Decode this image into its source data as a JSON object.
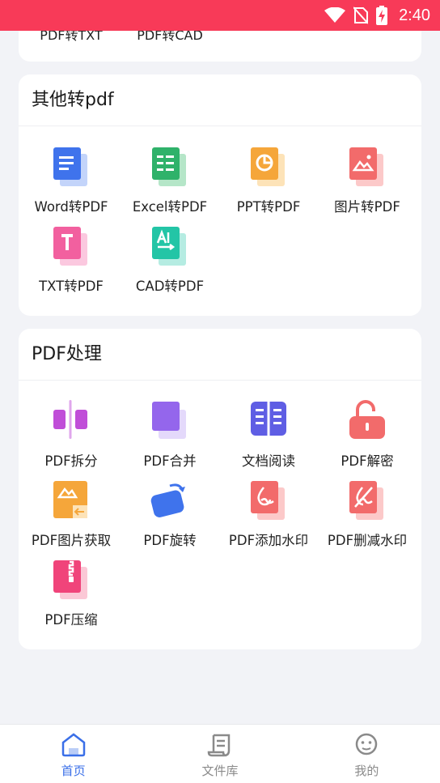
{
  "status_bar": {
    "time": "2:40"
  },
  "top_card": {
    "cut_items": [
      "PDF转TXT",
      "PDF转CAD"
    ]
  },
  "other_to_pdf": {
    "title": "其他转pdf",
    "items": [
      {
        "label": "Word转PDF",
        "icon": "word-doc-icon"
      },
      {
        "label": "Excel转PDF",
        "icon": "excel-sheet-icon"
      },
      {
        "label": "PPT转PDF",
        "icon": "ppt-chart-icon"
      },
      {
        "label": "图片转PDF",
        "icon": "image-icon"
      },
      {
        "label": "TXT转PDF",
        "icon": "txt-icon"
      },
      {
        "label": "CAD转PDF",
        "icon": "cad-icon"
      }
    ]
  },
  "pdf_tools": {
    "title": "PDF处理",
    "items": [
      {
        "label": "PDF拆分",
        "icon": "split-icon"
      },
      {
        "label": "PDF合并",
        "icon": "merge-icon"
      },
      {
        "label": "文档阅读",
        "icon": "book-icon"
      },
      {
        "label": "PDF解密",
        "icon": "unlock-icon"
      },
      {
        "label": "PDF图片获取",
        "icon": "image-extract-icon"
      },
      {
        "label": "PDF旋转",
        "icon": "rotate-icon"
      },
      {
        "label": "PDF添加水印",
        "icon": "watermark-add-icon"
      },
      {
        "label": "PDF删减水印",
        "icon": "watermark-remove-icon"
      },
      {
        "label": "PDF压缩",
        "icon": "zip-icon"
      }
    ]
  },
  "tabbar": {
    "tabs": [
      {
        "label": "首页",
        "icon": "home-icon",
        "active": true
      },
      {
        "label": "文件库",
        "icon": "scroll-icon",
        "active": false
      },
      {
        "label": "我的",
        "icon": "profile-face-icon",
        "active": false
      }
    ]
  },
  "colors": {
    "status_bar": "#f83a58",
    "accent": "#3a6fe8",
    "page_bg": "#f2f3f7"
  }
}
